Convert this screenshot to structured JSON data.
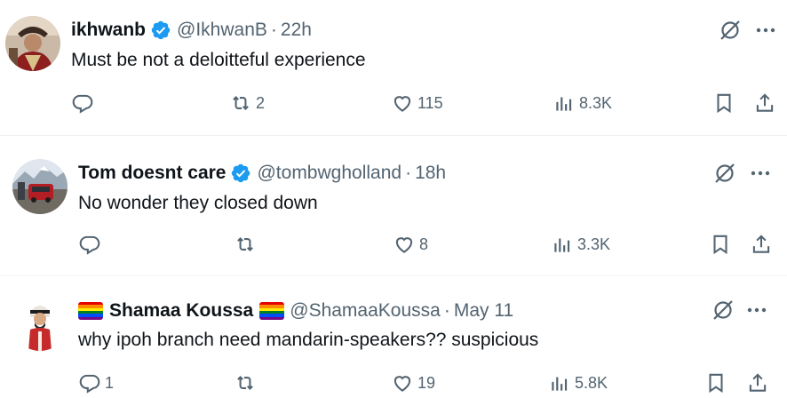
{
  "tweets": [
    {
      "name": "ikhwanb",
      "handle": "@IkhwanB",
      "separator": "·",
      "time": "22h",
      "text": "Must be not a deloitteful experience",
      "replies": "",
      "reposts": "2",
      "likes": "115",
      "views": "8.3K",
      "verified": true
    },
    {
      "name": "Tom doesnt care",
      "handle": "@tombwgholland",
      "separator": "·",
      "time": "18h",
      "text": "No wonder they closed down",
      "replies": "",
      "reposts": "",
      "likes": "8",
      "views": "3.3K",
      "verified": true
    },
    {
      "name": "Shamaa Koussa",
      "handle": "@ShamaaKoussa",
      "separator": "·",
      "time": "May 11",
      "text": "why ipoh branch need mandarin-speakers?? suspicious",
      "replies": "1",
      "reposts": "",
      "likes": "19",
      "views": "5.8K",
      "verified": false
    }
  ],
  "colors": {
    "text": "#0f1419",
    "secondary": "#536471",
    "verified": "#1d9bf0",
    "divider": "#eff3f4"
  },
  "icons": [
    "reply-icon",
    "retweet-icon",
    "like-icon",
    "views-icon",
    "bookmark-icon",
    "share-icon",
    "grok-icon",
    "more-icon",
    "verified-badge-icon",
    "rainbow-flag-icon"
  ]
}
